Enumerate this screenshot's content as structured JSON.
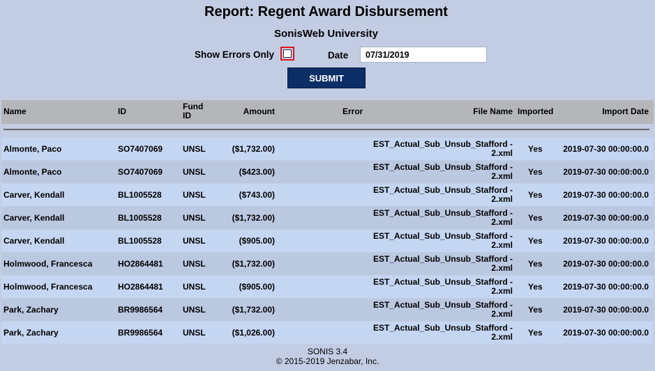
{
  "report": {
    "title": "Report: Regent Award Disbursement",
    "school": "SonisWeb University"
  },
  "filters": {
    "show_errors_label": "Show Errors Only",
    "date_label": "Date",
    "date_value": "07/31/2019",
    "submit_label": "SUBMIT"
  },
  "table": {
    "columns": [
      "Name",
      "ID",
      "Fund ID",
      "Amount",
      "Error",
      "File Name",
      "Imported",
      "Import Date"
    ],
    "rows": [
      {
        "name": "Almonte, Paco",
        "id": "SO7407069",
        "fund": "UNSL",
        "amount": "($1,732.00)",
        "error": "",
        "file_line1": "EST_Actual_Sub_Unsub_Stafford -",
        "file_line2": "2.xml",
        "imported": "Yes",
        "date": "2019-07-30 00:00:00.0"
      },
      {
        "name": "Almonte, Paco",
        "id": "SO7407069",
        "fund": "UNSL",
        "amount": "($423.00)",
        "error": "",
        "file_line1": "EST_Actual_Sub_Unsub_Stafford -",
        "file_line2": "2.xml",
        "imported": "Yes",
        "date": "2019-07-30 00:00:00.0"
      },
      {
        "name": "Carver, Kendall",
        "id": "BL1005528",
        "fund": "UNSL",
        "amount": "($743.00)",
        "error": "",
        "file_line1": "EST_Actual_Sub_Unsub_Stafford -",
        "file_line2": "2.xml",
        "imported": "Yes",
        "date": "2019-07-30 00:00:00.0"
      },
      {
        "name": "Carver, Kendall",
        "id": "BL1005528",
        "fund": "UNSL",
        "amount": "($1,732.00)",
        "error": "",
        "file_line1": "EST_Actual_Sub_Unsub_Stafford -",
        "file_line2": "2.xml",
        "imported": "Yes",
        "date": "2019-07-30 00:00:00.0"
      },
      {
        "name": "Carver, Kendall",
        "id": "BL1005528",
        "fund": "UNSL",
        "amount": "($905.00)",
        "error": "",
        "file_line1": "EST_Actual_Sub_Unsub_Stafford -",
        "file_line2": "2.xml",
        "imported": "Yes",
        "date": "2019-07-30 00:00:00.0"
      },
      {
        "name": "Holmwood, Francesca",
        "id": "HO2864481",
        "fund": "UNSL",
        "amount": "($1,732.00)",
        "error": "",
        "file_line1": "EST_Actual_Sub_Unsub_Stafford -",
        "file_line2": "2.xml",
        "imported": "Yes",
        "date": "2019-07-30 00:00:00.0"
      },
      {
        "name": "Holmwood, Francesca",
        "id": "HO2864481",
        "fund": "UNSL",
        "amount": "($905.00)",
        "error": "",
        "file_line1": "EST_Actual_Sub_Unsub_Stafford -",
        "file_line2": "2.xml",
        "imported": "Yes",
        "date": "2019-07-30 00:00:00.0"
      },
      {
        "name": "Park, Zachary",
        "id": "BR9986564",
        "fund": "UNSL",
        "amount": "($1,732.00)",
        "error": "",
        "file_line1": "EST_Actual_Sub_Unsub_Stafford -",
        "file_line2": "2.xml",
        "imported": "Yes",
        "date": "2019-07-30 00:00:00.0"
      },
      {
        "name": "Park, Zachary",
        "id": "BR9986564",
        "fund": "UNSL",
        "amount": "($1,026.00)",
        "error": "",
        "file_line1": "EST_Actual_Sub_Unsub_Stafford -",
        "file_line2": "2.xml",
        "imported": "Yes",
        "date": "2019-07-30 00:00:00.0"
      }
    ]
  },
  "footer": {
    "version": "SONIS 3.4",
    "copyright": "© 2015-2019 Jenzabar, Inc."
  },
  "colors": {
    "background": "#c2cde3",
    "header_bg": "#b4b6b9",
    "row_light": "#c5d6f2",
    "row_dark": "#bac8e0",
    "submit_bg": "#0b2e67",
    "highlight_border": "#e0141e"
  }
}
